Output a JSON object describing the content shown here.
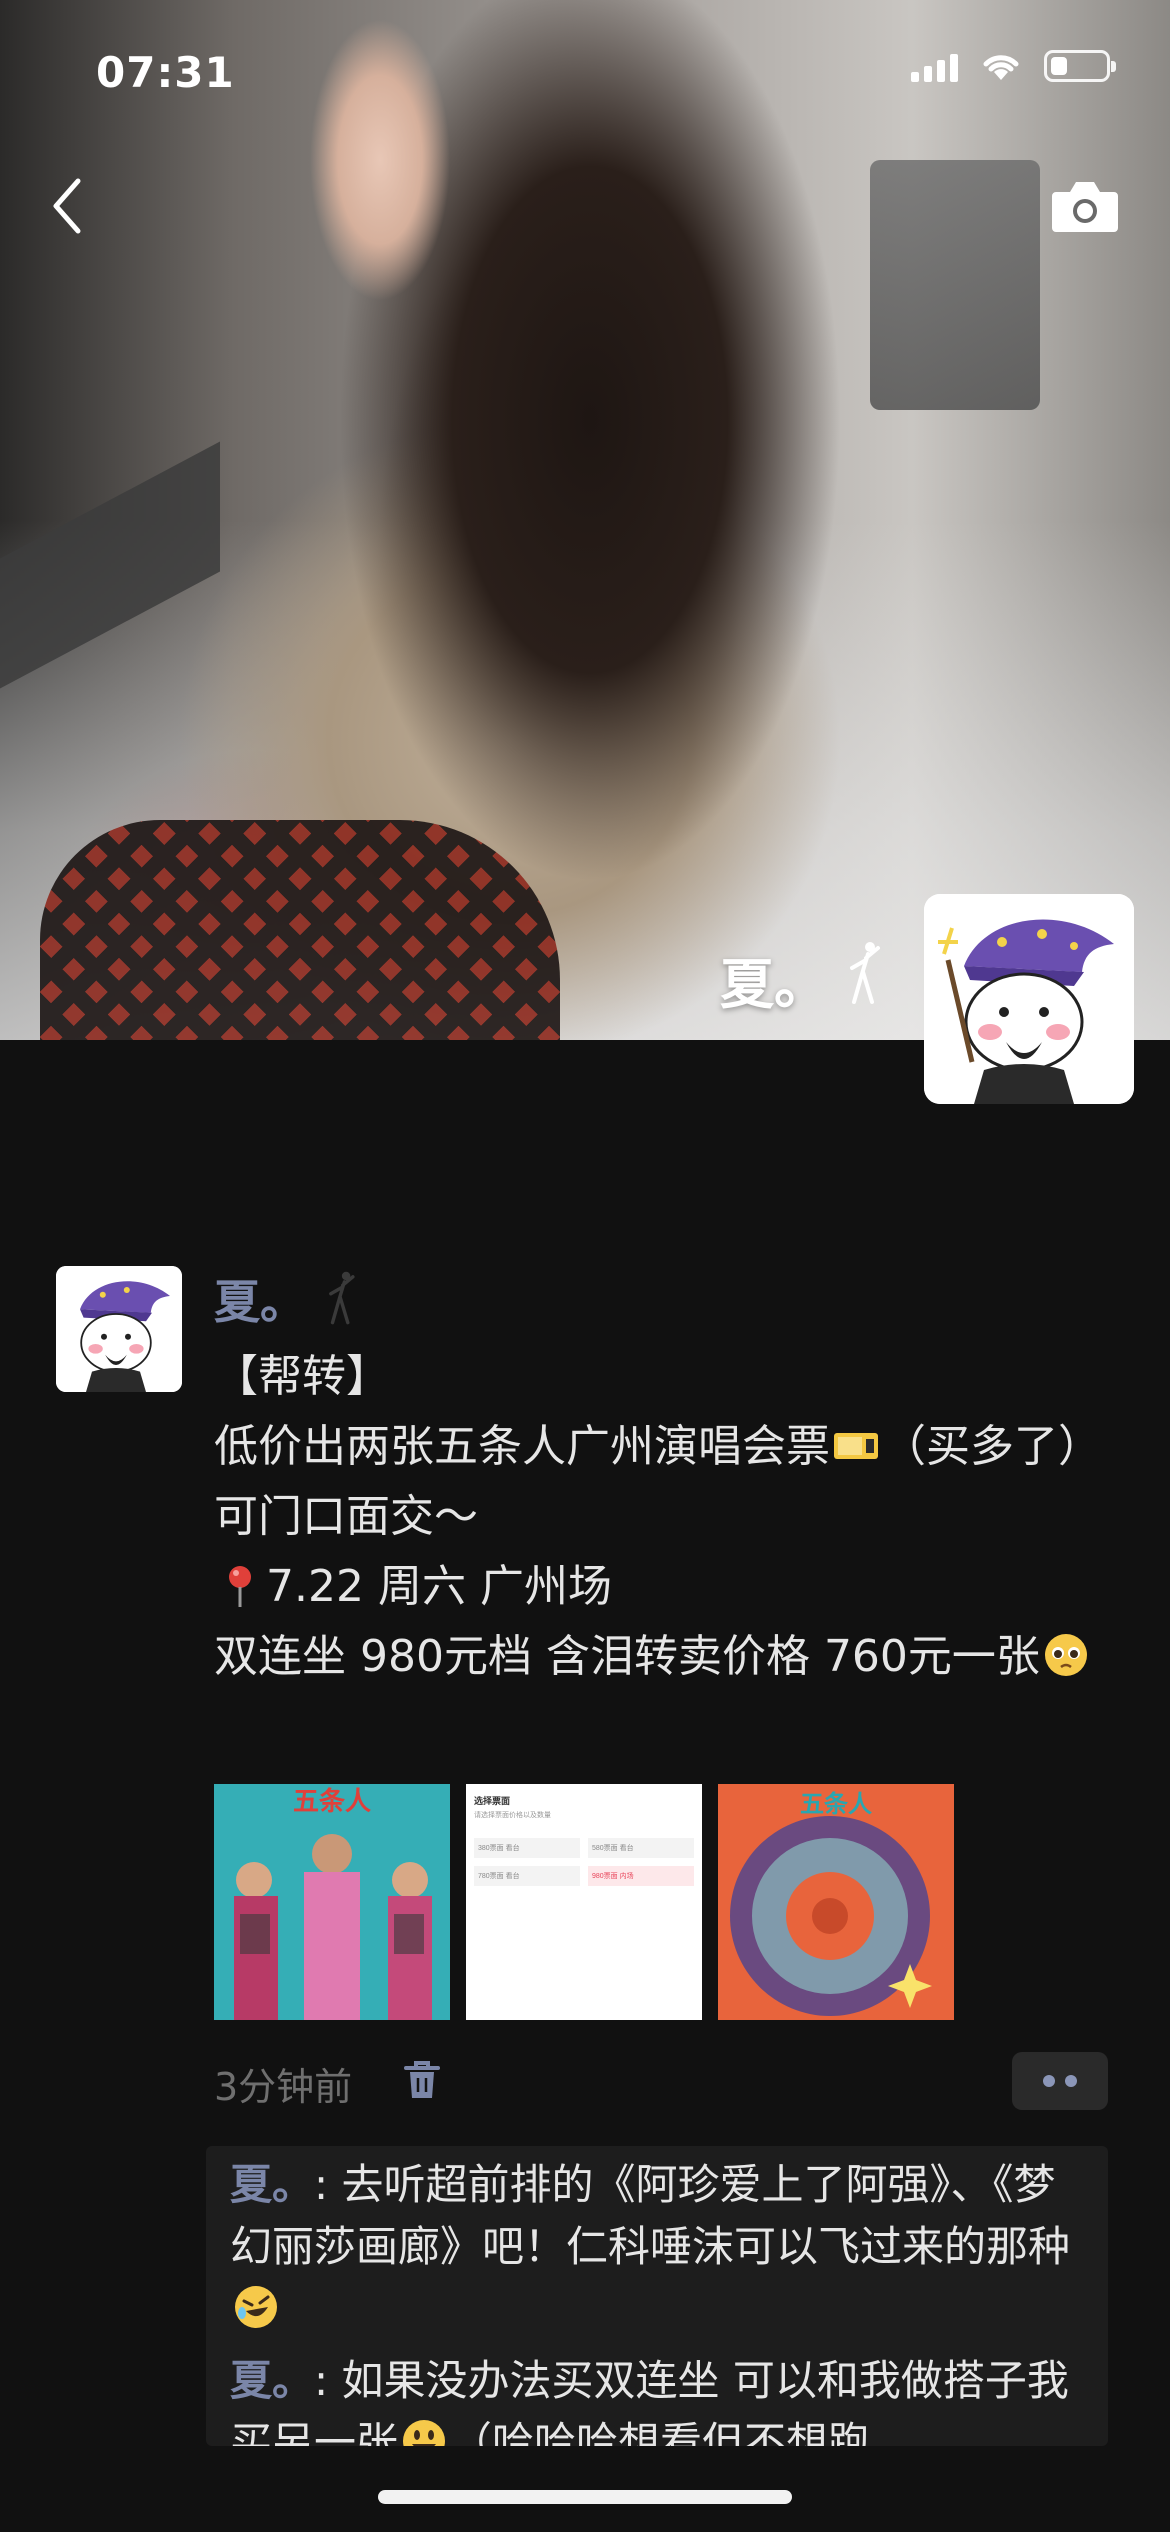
{
  "status_bar": {
    "time": "07:31"
  },
  "cover": {
    "name": "夏。"
  },
  "post": {
    "author": "夏。",
    "lines": [
      "【帮转】",
      "低价出两张五条人广州演唱会票",
      "（买多了）可门口面交～",
      "7.22 周六 广州场",
      "双连坐 980元档 含泪转卖价格 760元一张"
    ],
    "time_ago": "3分钟前",
    "thumbnails": [
      {
        "caption": ""
      },
      {
        "header": "选择票面",
        "subheader": "请选择票面价格以及数量",
        "options": [
          "380票面 看台",
          "580票面 看台",
          "780票面 看台",
          "980票面 内场"
        ]
      },
      {
        "caption": ""
      }
    ]
  },
  "comments": [
    {
      "author": "夏。",
      "text": "去听超前排的《阿珍爱上了阿强》、《梦幻丽莎画廊》吧！仁科唾沫可以飞过来的那种"
    },
    {
      "author": "夏。",
      "text": "如果没办法买双连坐 可以和我做搭子我买另一张",
      "text_after_emoji": "（哈哈哈想看但不想跑"
    }
  ],
  "icons": {
    "back": "chevron-left-icon",
    "camera": "camera-icon",
    "delete": "trash-icon",
    "more": "more-dots-icon",
    "ticket": "ticket-emoji",
    "pin": "round-pushpin-emoji",
    "pleading": "pleading-face-emoji",
    "laughing": "rolling-laughing-emoji",
    "smiley": "smiley-emoji"
  },
  "colors": {
    "background": "#111111",
    "author_name": "#7b86a8",
    "text": "#e6e6e6",
    "secondary_text": "#6f6f6f",
    "comment_bg": "#1d1d1d"
  }
}
